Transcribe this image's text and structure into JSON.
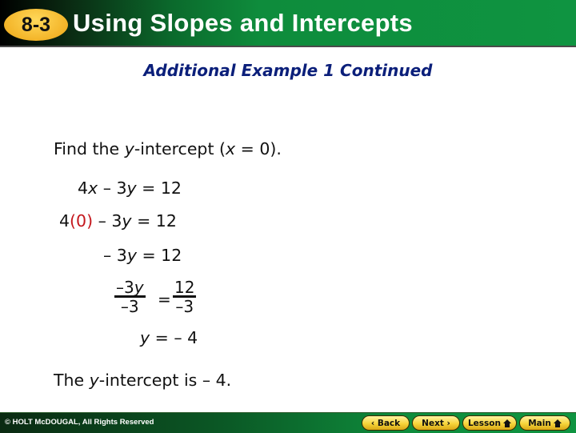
{
  "header": {
    "lesson_number": "8-3",
    "title": "Using Slopes and Intercepts"
  },
  "subtitle": "Additional Example 1 Continued",
  "content": {
    "instruction": {
      "prefix": "Find the ",
      "var_y": "y",
      "middle": "-intercept (",
      "var_x": "x",
      "suffix": " = 0)."
    },
    "step1": {
      "a": "4",
      "x": "x",
      "b": " – 3",
      "y": "y",
      "c": " = 12"
    },
    "step2": {
      "a": "4",
      "sub": "(0)",
      "b": " – 3",
      "y": "y",
      "c": " = 12"
    },
    "step3": {
      "a": "– 3",
      "y": "y",
      "c": " = 12"
    },
    "step4": {
      "left_num_a": "–3",
      "left_num_y": "y",
      "left_den": "–3",
      "equals": "=",
      "right_num": "12",
      "right_den": "–3"
    },
    "step5": {
      "y": "y",
      "c": " = – 4"
    },
    "conclusion": {
      "prefix": "The ",
      "y": "y",
      "suffix": "-intercept is – 4."
    }
  },
  "footer": {
    "copyright": "© HOLT McDOUGAL, All Rights Reserved",
    "buttons": {
      "back": "‹ Back",
      "next": "Next ›",
      "lesson": "Lesson",
      "main": "Main"
    }
  },
  "colors": {
    "substitution_red": "#c4161c",
    "subtitle_blue": "#0b1f7a",
    "header_green": "#0f9441",
    "badge_yellow": "#f3b428"
  }
}
